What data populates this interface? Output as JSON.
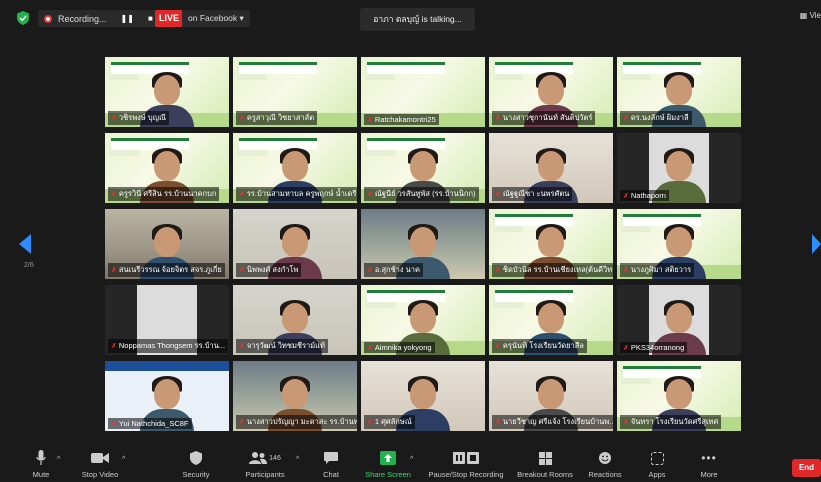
{
  "topbar": {
    "recording_label": "Recording...",
    "live_label": "LIVE",
    "on_facebook_label": "on Facebook ▾",
    "talking_text": "อาภา ตลบุญ์ is talking...",
    "view_label": "Vie"
  },
  "pager": {
    "page": "2/6"
  },
  "participants": [
    {
      "name": "วชิรพงษ์ บุญณี"
    },
    {
      "name": "ครูสาวุณี วิชยาสาส์ต"
    },
    {
      "name": "Ratchakamontri25"
    },
    {
      "name": "นางสาวชุกานันท์ สันติปวัตร์"
    },
    {
      "name": "ดร.นงลักษ์ ผิมงาลี"
    },
    {
      "name": "ครูรวินี ศรีสิน รร.บ้านนาคกบก"
    },
    {
      "name": "รร.บ้านสามหาบล ครูพฤกษ์ น้ำเดรี"
    },
    {
      "name": "ณัฐนีย์ วรสันทูพัส (รร.บ้านนิกก)"
    },
    {
      "name": "ณัฐฐูณีชา ะนพรศัตน"
    },
    {
      "name": "Nathaporn"
    },
    {
      "name": "สนเนรีวรรณ จ้อยจิตร สจร.ภูเกี่ย"
    },
    {
      "name": "นิพพงศ์ สงกำโพ"
    },
    {
      "name": "อ.สุกช้าง นาค"
    },
    {
      "name": "ชิดบัวนิล รร.บ้านเชียงเหล(ต้นดีวิทย์)"
    },
    {
      "name": "นางภูศิมา สติยวาร"
    },
    {
      "name": "Noppamas Thongsem รร.บ้าน..."
    },
    {
      "name": "จารุวัฒน์ วิทชมชีราม์แท้"
    },
    {
      "name": "Aimnika yokyong"
    },
    {
      "name": "ครุนันทิ โรงเรียนวัดยาสีล"
    },
    {
      "name": "PKS34orranong"
    },
    {
      "name": "Yui Nathchida_SC8F"
    },
    {
      "name": "นางสาวปรัญญา มะดาสะ รร.บ้านพ..."
    },
    {
      "name": "1 ศุศลักษณ์"
    },
    {
      "name": "นายวีชาญ ศรีแจ้ง โรงเรียนบ้านพ..."
    },
    {
      "name": "จันทรา โรงเรียนวัดศรีสุเทศ"
    }
  ],
  "toolbar": {
    "mute": "Mute",
    "stop_video": "Stop Video",
    "security": "Security",
    "participants": "Participants",
    "participant_count": "146",
    "chat": "Chat",
    "share_screen": "Share Screen",
    "pause_recording": "Pause/Stop Recording",
    "breakout_rooms": "Breakout Rooms",
    "reactions": "Reactions",
    "apps": "Apps",
    "more": "More",
    "end": "End"
  },
  "colors": {
    "live": "#e02828",
    "share": "#4bd16a",
    "end": "#e02828",
    "accent_blue": "#2d8cff"
  }
}
